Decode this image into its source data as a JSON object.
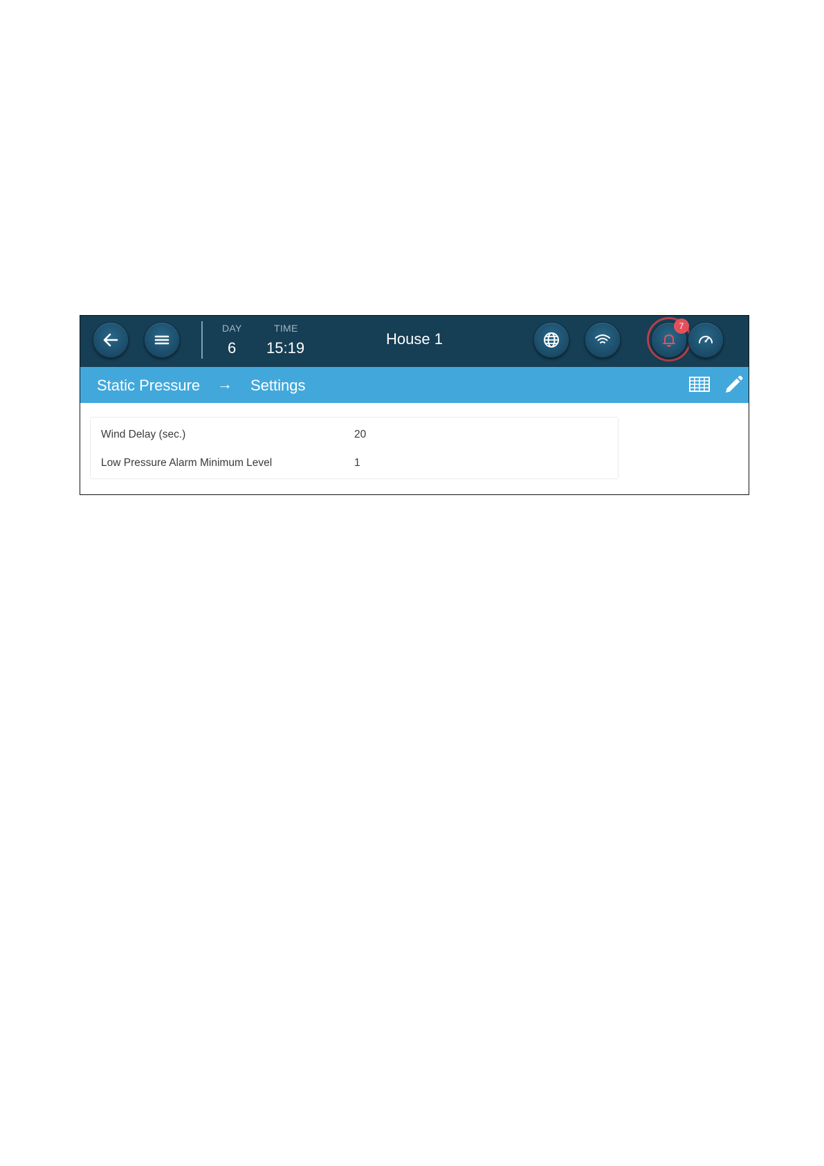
{
  "header": {
    "day_label": "DAY",
    "day_value": "6",
    "time_label": "TIME",
    "time_value": "15:19",
    "house_name": "House 1",
    "alarm_count": "7",
    "alarm_ring_color": "#b7404a",
    "bar_color": "#163e54"
  },
  "icons": {
    "back": "arrow-left-icon",
    "menu": "hamburger-menu-icon",
    "globe": "globe-icon",
    "network": "wifi-icon",
    "alarm": "bell-icon",
    "gauge": "gauge-icon",
    "table": "table-grid-icon",
    "edit": "pencil-icon"
  },
  "breadcrumb": {
    "section": "Static Pressure",
    "separator": "→",
    "page": "Settings",
    "bar_color": "#42a8dc"
  },
  "settings": {
    "rows": [
      {
        "label": "Wind Delay (sec.)",
        "value": "20"
      },
      {
        "label": "Low Pressure Alarm Minimum Level",
        "value": "1"
      }
    ]
  }
}
